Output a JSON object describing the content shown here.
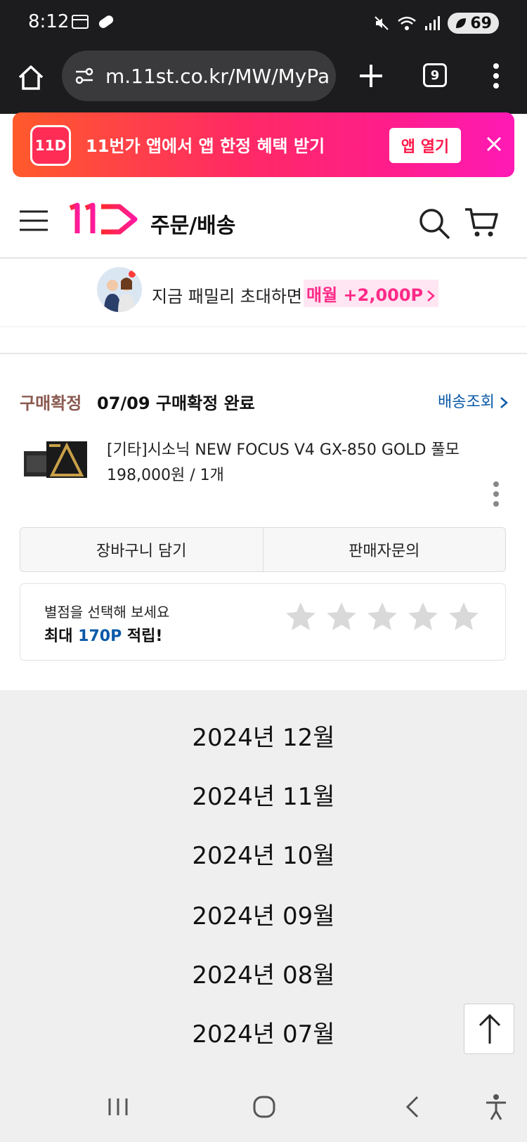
{
  "status_bar": {
    "time": "8:12",
    "battery": "69"
  },
  "browser": {
    "url": "m.11st.co.kr/MW/MyPa",
    "tab_count": "9"
  },
  "app_banner": {
    "logo_text": "11D",
    "text": "11번가 앱에서 앱 한정 혜택 받기",
    "open_label": "앱 열기"
  },
  "header": {
    "title": "주문/배송"
  },
  "promo": {
    "text": "지금 패밀리 초대하면",
    "highlight": "매월 +2,000P"
  },
  "order": {
    "status": "구매확정",
    "status_detail": "07/09 구매확정 완료",
    "track_label": "배송조회",
    "product_name": "[기타]시소닉 NEW FOCUS V4 GX-850 GOLD 풀모",
    "price_qty": "198,000원 / 1개",
    "buttons": [
      "장바구니 담기",
      "판매자문의"
    ]
  },
  "review": {
    "line1": "별점을 선택해 보세요",
    "prefix": "최대 ",
    "points": "170P",
    "suffix": " 적립!"
  },
  "months": [
    "2024년 12월",
    "2024년 11월",
    "2024년 10월",
    "2024년 09월",
    "2024년 08월",
    "2024년 07월"
  ],
  "colors": {
    "brand": "#ff2a63",
    "link": "#0b5aa8",
    "status": "#8a5a50"
  }
}
